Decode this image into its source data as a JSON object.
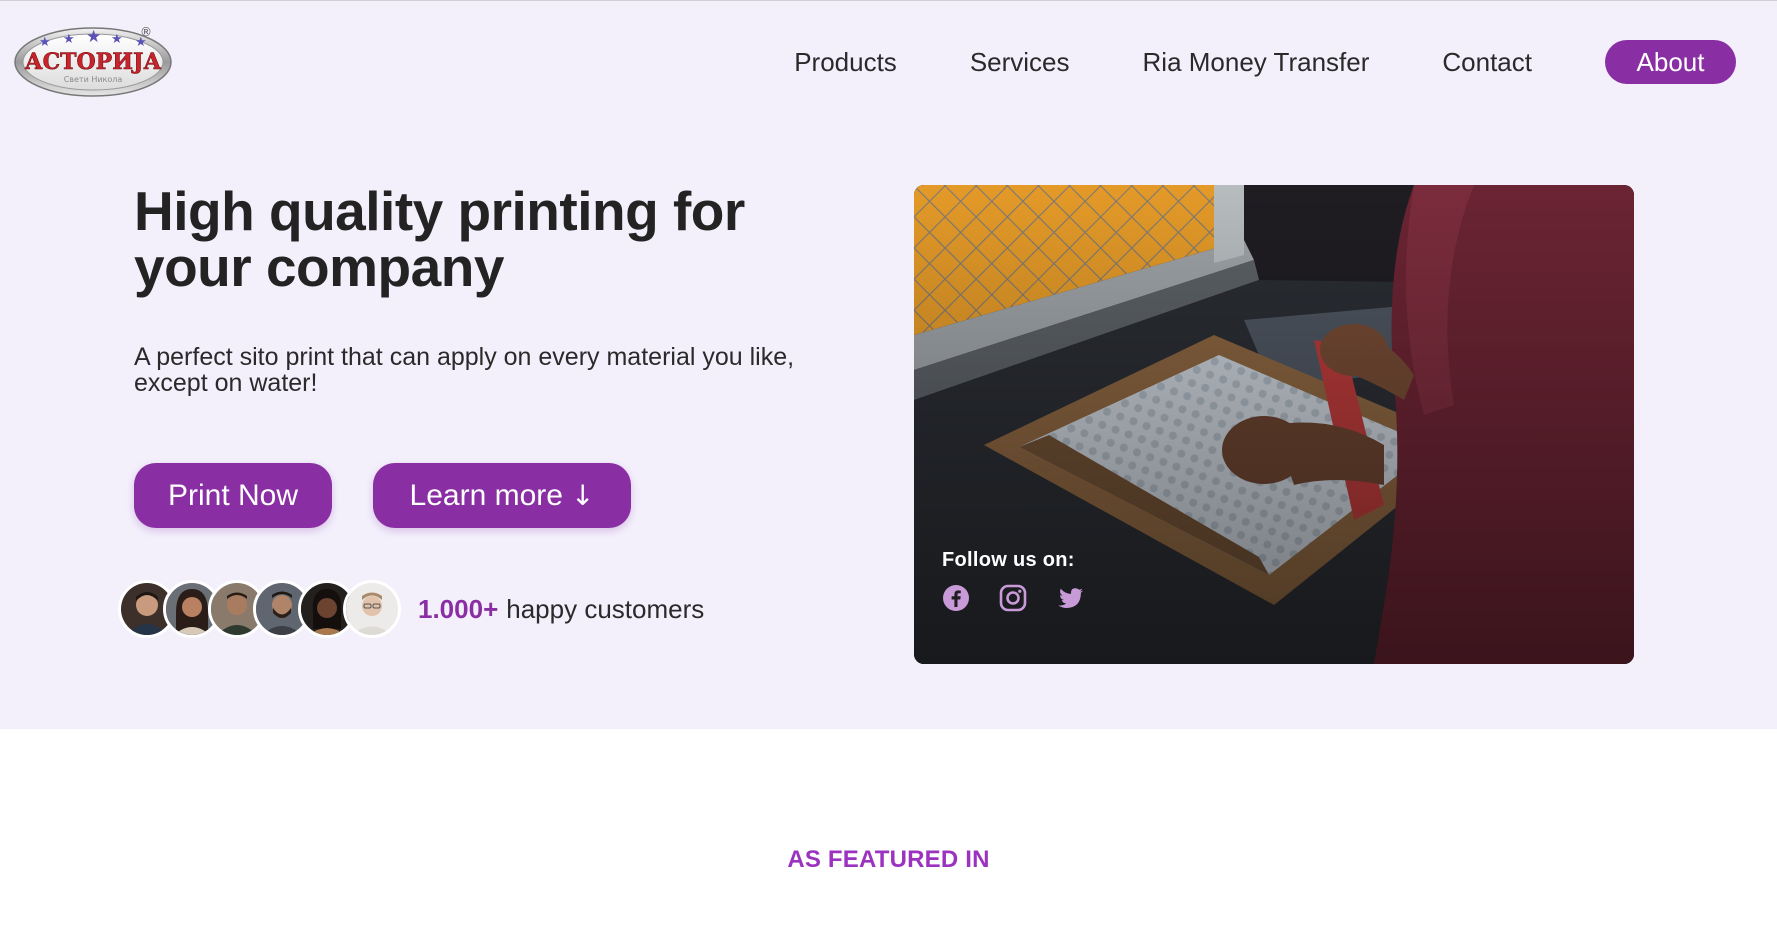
{
  "brand": {
    "logo_text": "АСТОРИЈА",
    "logo_subtext": "Свети Никола",
    "logo_registered": "®"
  },
  "nav": {
    "items": [
      {
        "label": "Products"
      },
      {
        "label": "Services"
      },
      {
        "label": "Ria Money Transfer"
      },
      {
        "label": "Contact"
      }
    ],
    "cta_label": "About"
  },
  "hero": {
    "title": "High quality printing for your company",
    "subtitle": "A perfect sito print that can apply on every material you like, except on water!",
    "primary_button": "Print Now",
    "secondary_button": "Learn more",
    "secondary_button_icon": "↓",
    "customers_count": "1.000+",
    "customers_text": "happy customers",
    "avatar_count": 6,
    "follow_label": "Follow us on:",
    "socials": [
      "facebook-icon",
      "instagram-icon",
      "twitter-icon"
    ]
  },
  "featured": {
    "heading": "AS FEATURED IN"
  },
  "colors": {
    "accent": "#8a2fa3",
    "hero_bg": "#f3f0fc",
    "featured_text": "#9b33c0"
  }
}
